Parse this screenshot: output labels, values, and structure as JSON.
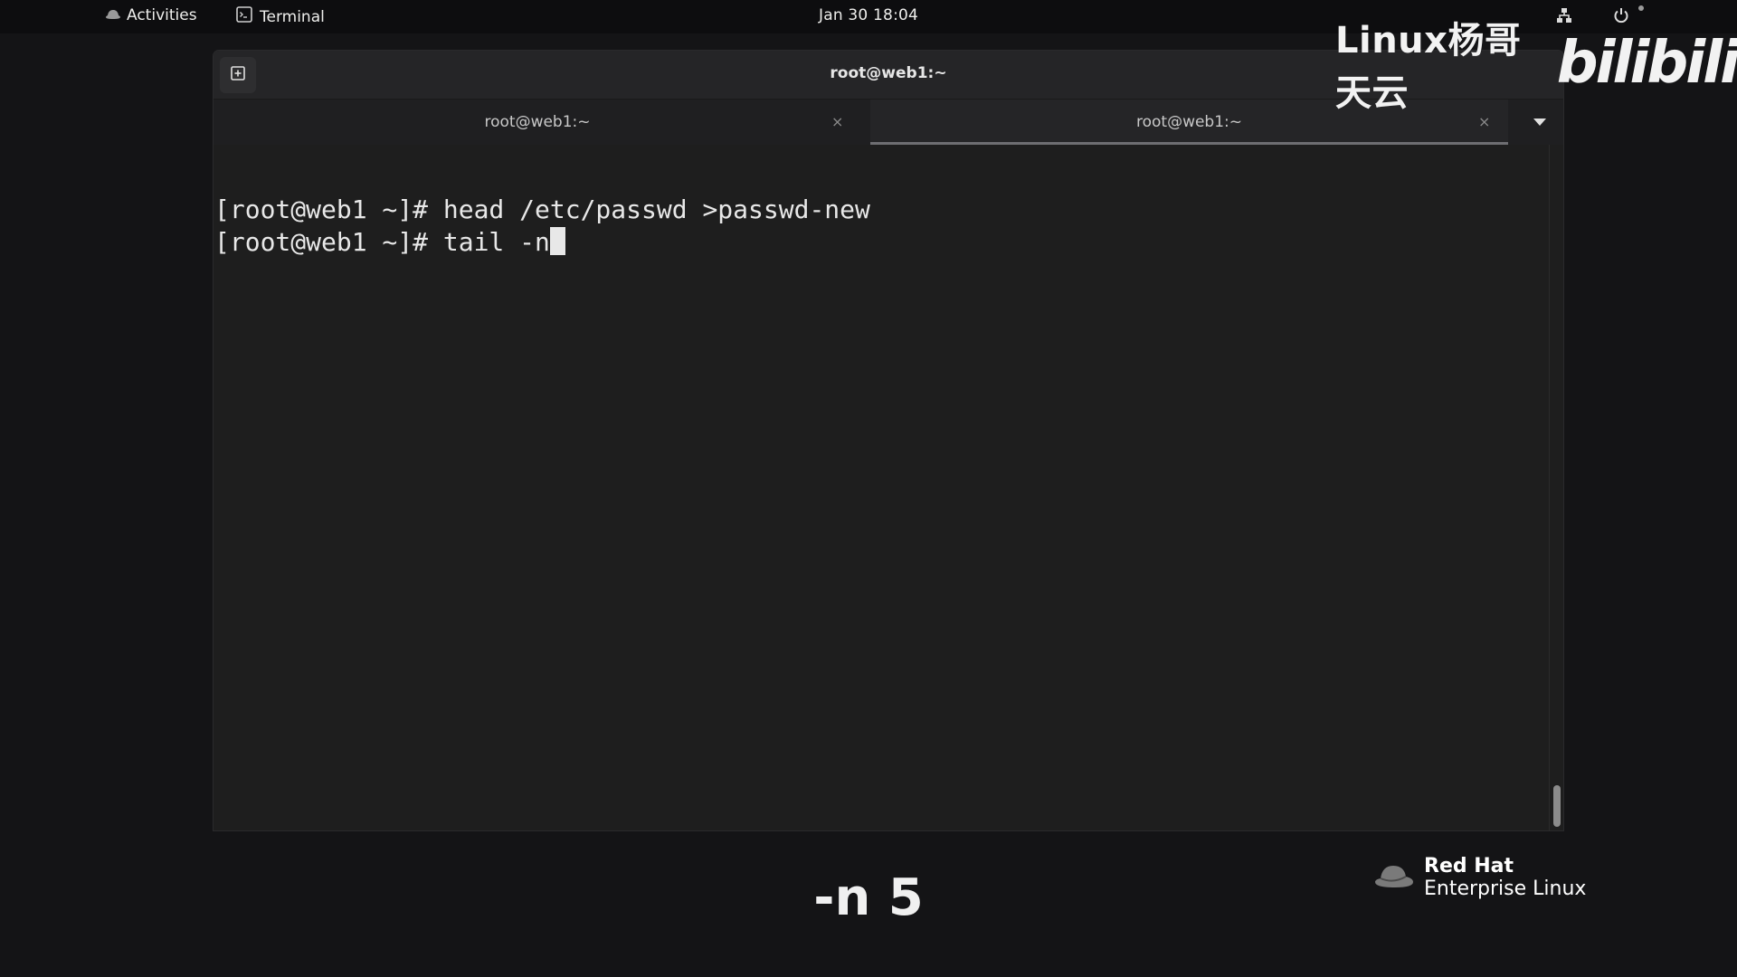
{
  "topbar": {
    "activities_label": "Activities",
    "app_label": "Terminal",
    "clock": "Jan 30  18:04"
  },
  "window": {
    "title": "root@web1:~",
    "tabs": [
      {
        "label": "root@web1:~",
        "close": "×",
        "active": false
      },
      {
        "label": "root@web1:~",
        "close": "×",
        "active": true
      }
    ]
  },
  "terminal": {
    "lines": [
      "[root@web1 ~]# head /etc/passwd >passwd-new",
      "[root@web1 ~]# tail -n"
    ]
  },
  "overlay": {
    "watermark_text": "Linux杨哥天云",
    "watermark_logo": "bilibili",
    "subtitle": "-n 5",
    "brand_line1": "Red Hat",
    "brand_line2": "Enterprise Linux"
  },
  "colors": {
    "background": "#141416",
    "terminal_bg": "#1e1e1e",
    "terminal_fg": "#e8e8e8",
    "redhat_hat": "#7a7a7a"
  },
  "icons": {
    "activities": "redhat-fedora-icon",
    "app": "terminal-icon",
    "network": "network-icon",
    "power": "power-icon",
    "new_tab": "new-tab-icon",
    "tab_menu": "chevron-down-icon"
  }
}
